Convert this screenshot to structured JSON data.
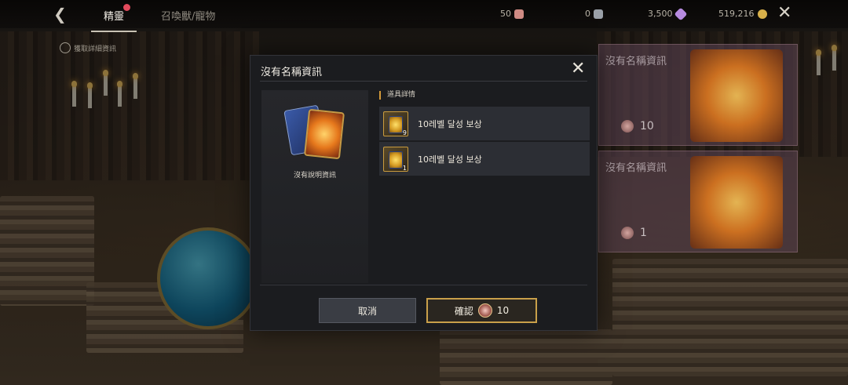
{
  "topbar": {
    "tab_active": "精靈",
    "tab_2": "召喚獸/寵物",
    "currencies": [
      {
        "value": "50",
        "icon": "ticket-icon",
        "color": "#d08b84"
      },
      {
        "value": "0",
        "icon": "scroll-icon",
        "color": "#9aa0a8"
      },
      {
        "value": "3,500",
        "icon": "gem-icon",
        "color": "#b78be0"
      },
      {
        "value": "519,216",
        "icon": "gold-coin-icon",
        "color": "#d8b04a"
      }
    ]
  },
  "subtip": "獲取詳細資訊",
  "background_cards": [
    {
      "title": "沒有名稱資訊",
      "count": "10"
    },
    {
      "title": "沒有名稱資訊",
      "count": "1"
    }
  ],
  "dialog": {
    "title": "沒有名稱資訊",
    "description": "沒有說明資訊",
    "section_label": "道具詳情",
    "rewards": [
      {
        "label": "10레벨 달성 보상",
        "count": "9"
      },
      {
        "label": "10레벨 달성 보상",
        "count": "1"
      }
    ],
    "cancel_label": "取消",
    "confirm_label": "確認",
    "confirm_cost": "10"
  },
  "colors": {
    "accent_gold": "#c9a04a",
    "panel": "#1b1c1f",
    "row": "#2c2e34"
  }
}
